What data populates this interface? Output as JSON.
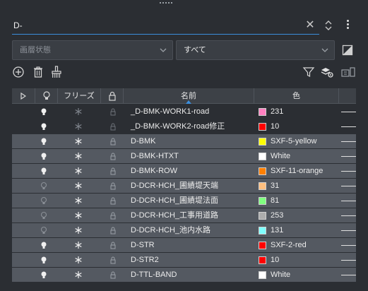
{
  "search": {
    "value": "D-"
  },
  "filters": {
    "state_label": "画層状態",
    "scope_label": "すべて"
  },
  "table": {
    "columns": {
      "freeze": "フリーズ",
      "name": "名前",
      "color": "色"
    },
    "rows": [
      {
        "name": "_D-BMK-WORK1-road",
        "color_name": "231",
        "swatch": "#ff80c0",
        "on": true,
        "frozen": false,
        "locked": false,
        "selected": false
      },
      {
        "name": "_D-BMK-WORK2-road修正",
        "color_name": "10",
        "swatch": "#ff0000",
        "on": true,
        "frozen": false,
        "locked": false,
        "selected": false
      },
      {
        "name": "D-BMK",
        "color_name": "SXF-5-yellow",
        "swatch": "#ffff00",
        "on": true,
        "frozen": false,
        "locked": false,
        "selected": true
      },
      {
        "name": "D-BMK-HTXT",
        "color_name": "White",
        "swatch": "#ffffff",
        "on": true,
        "frozen": false,
        "locked": false,
        "selected": true
      },
      {
        "name": "D-BMK-ROW",
        "color_name": "SXF-11-orange",
        "swatch": "#ff8000",
        "on": true,
        "frozen": false,
        "locked": false,
        "selected": true
      },
      {
        "name": "D-DCR-HCH_圃績堤天端",
        "color_name": "31",
        "swatch": "#ffbf7f",
        "on": false,
        "frozen": false,
        "locked": false,
        "selected": true
      },
      {
        "name": "D-DCR-HCH_圃績堤法面",
        "color_name": "81",
        "swatch": "#7fff7f",
        "on": false,
        "frozen": false,
        "locked": false,
        "selected": true
      },
      {
        "name": "D-DCR-HCH_工事用道路",
        "color_name": "253",
        "swatch": "#adadad",
        "on": false,
        "frozen": false,
        "locked": false,
        "selected": true
      },
      {
        "name": "D-DCR-HCH_池内水路",
        "color_name": "131",
        "swatch": "#7fffff",
        "on": false,
        "frozen": false,
        "locked": false,
        "selected": true
      },
      {
        "name": "D-STR",
        "color_name": "SXF-2-red",
        "swatch": "#ff0000",
        "on": true,
        "frozen": false,
        "locked": false,
        "selected": true
      },
      {
        "name": "D-STR2",
        "color_name": "10",
        "swatch": "#ff0000",
        "on": true,
        "frozen": false,
        "locked": false,
        "selected": true
      },
      {
        "name": "D-TTL-BAND",
        "color_name": "White",
        "swatch": "#ffffff",
        "on": true,
        "frozen": false,
        "locked": false,
        "selected": true
      }
    ]
  }
}
